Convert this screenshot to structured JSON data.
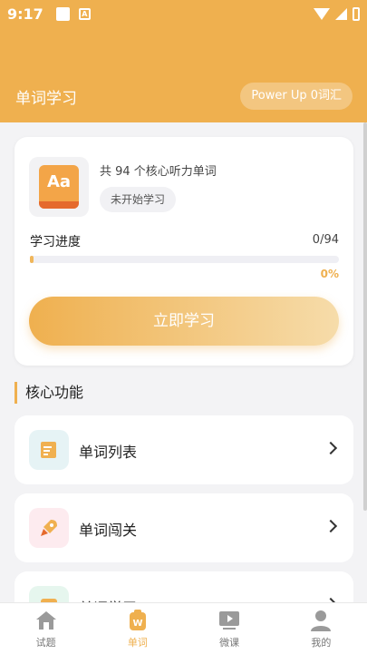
{
  "status_bar": {
    "time": "9:17",
    "icon_a": "A"
  },
  "header": {
    "title": "单词学习",
    "pill": "Power Up 0词汇"
  },
  "card": {
    "icon_text": "Aa",
    "description": "共 94 个核心听力单词",
    "status_chip": "未开始学习",
    "progress_label": "学习进度",
    "progress_count": "0/94",
    "progress_percent": "0%",
    "progress_value": 0,
    "start_button": "立即学习"
  },
  "section": {
    "title": "核心功能"
  },
  "features": [
    {
      "label": "单词列表",
      "icon": "notepad-icon",
      "bg": "#e6f3f5"
    },
    {
      "label": "单词闯关",
      "icon": "rocket-icon",
      "bg": "#fdebef"
    },
    {
      "label": "单词学习",
      "icon": "book-icon",
      "bg": "#e6f6ee"
    }
  ],
  "tabs": [
    {
      "label": "试题",
      "icon": "home-icon",
      "active": false
    },
    {
      "label": "单词",
      "icon": "word-book-icon",
      "active": true
    },
    {
      "label": "微课",
      "icon": "video-icon",
      "active": false
    },
    {
      "label": "我的",
      "icon": "user-icon",
      "active": false
    }
  ],
  "colors": {
    "accent": "#efb04f",
    "background": "#f3f3f5"
  }
}
